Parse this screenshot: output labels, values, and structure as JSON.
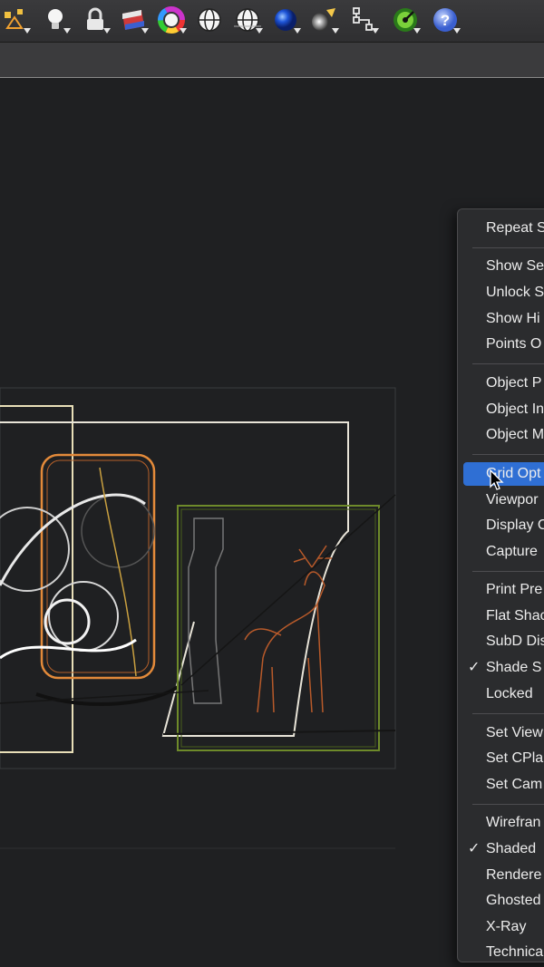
{
  "toolbar": {
    "buttons": [
      {
        "icon": "select-points-icon"
      },
      {
        "icon": "lightbulb-icon"
      },
      {
        "icon": "lock-icon"
      },
      {
        "icon": "layer-colors-icon"
      },
      {
        "icon": "color-wheel-icon"
      },
      {
        "icon": "wireframe-sphere-icon"
      },
      {
        "icon": "grid-sphere-icon"
      },
      {
        "icon": "shaded-sphere-icon"
      },
      {
        "icon": "render-light-icon"
      },
      {
        "icon": "hierarchy-icon"
      },
      {
        "icon": "green-globe-icon"
      },
      {
        "icon": "help-icon"
      }
    ]
  },
  "context_menu": {
    "highlighted_item": "Grid Opt",
    "items": [
      {
        "label": "Repeat S",
        "checked": false
      },
      {
        "label": "Show Se",
        "checked": false
      },
      {
        "label": "Unlock S",
        "checked": false
      },
      {
        "label": "Show Hi",
        "checked": false
      },
      {
        "label": "Points O",
        "checked": false
      },
      {
        "label": "Object P",
        "checked": false
      },
      {
        "label": "Object In",
        "checked": false
      },
      {
        "label": "Object M",
        "checked": false
      },
      {
        "label": "Grid Opt",
        "checked": false
      },
      {
        "label": "Viewpor",
        "checked": false
      },
      {
        "label": "Display C",
        "checked": false
      },
      {
        "label": "Capture",
        "checked": false
      },
      {
        "label": "Print Pre",
        "checked": false
      },
      {
        "label": "Flat Shac",
        "checked": false
      },
      {
        "label": "SubD Dis",
        "checked": false
      },
      {
        "label": "Shade S",
        "checked": true
      },
      {
        "label": "Locked",
        "checked": false
      },
      {
        "label": "Set View",
        "checked": false
      },
      {
        "label": "Set CPla",
        "checked": false
      },
      {
        "label": "Set Cam",
        "checked": false
      },
      {
        "label": "Wirefran",
        "checked": false
      },
      {
        "label": "Shaded",
        "checked": true
      },
      {
        "label": "Rendere",
        "checked": false
      },
      {
        "label": "Ghosted",
        "checked": false
      },
      {
        "label": "X-Ray",
        "checked": false
      },
      {
        "label": "Technica",
        "checked": false
      }
    ],
    "check_glyph": "✓"
  },
  "colors": {
    "highlight": "#2f6fd4",
    "menu_bg": "#2b2c2e",
    "viewport_bg": "#1f2022"
  }
}
